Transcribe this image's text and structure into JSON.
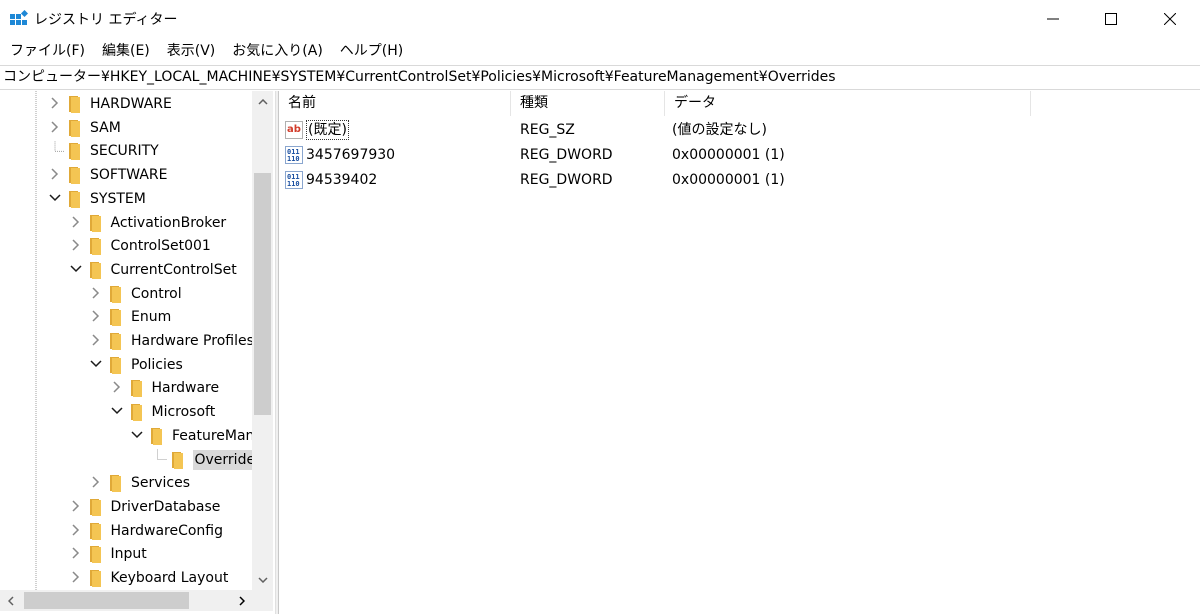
{
  "window": {
    "title": "レジストリ エディター",
    "minimize_icon": "minimize-icon",
    "maximize_icon": "maximize-icon",
    "close_icon": "close-icon"
  },
  "menu": [
    {
      "label": "ファイル(F)"
    },
    {
      "label": "編集(E)"
    },
    {
      "label": "表示(V)"
    },
    {
      "label": "お気に入り(A)"
    },
    {
      "label": "ヘルプ(H)"
    }
  ],
  "address": "コンピューター¥HKEY_LOCAL_MACHINE¥SYSTEM¥CurrentControlSet¥Policies¥Microsoft¥FeatureManagement¥Overrides",
  "tree": [
    {
      "label": "HARDWARE",
      "depth": 0,
      "state": "collapsed"
    },
    {
      "label": "SAM",
      "depth": 0,
      "state": "collapsed"
    },
    {
      "label": "SECURITY",
      "depth": 0,
      "state": "leaf"
    },
    {
      "label": "SOFTWARE",
      "depth": 0,
      "state": "collapsed"
    },
    {
      "label": "SYSTEM",
      "depth": 0,
      "state": "expanded"
    },
    {
      "label": "ActivationBroker",
      "depth": 1,
      "state": "collapsed"
    },
    {
      "label": "ControlSet001",
      "depth": 1,
      "state": "collapsed"
    },
    {
      "label": "CurrentControlSet",
      "depth": 1,
      "state": "expanded"
    },
    {
      "label": "Control",
      "depth": 2,
      "state": "collapsed"
    },
    {
      "label": "Enum",
      "depth": 2,
      "state": "collapsed"
    },
    {
      "label": "Hardware Profiles",
      "depth": 2,
      "state": "collapsed"
    },
    {
      "label": "Policies",
      "depth": 2,
      "state": "expanded"
    },
    {
      "label": "Hardware",
      "depth": 3,
      "state": "collapsed"
    },
    {
      "label": "Microsoft",
      "depth": 3,
      "state": "expanded"
    },
    {
      "label": "FeatureMana",
      "depth": 4,
      "state": "expanded"
    },
    {
      "label": "Overrides",
      "depth": 5,
      "state": "leaf",
      "selected": true
    },
    {
      "label": "Services",
      "depth": 2,
      "state": "collapsed"
    },
    {
      "label": "DriverDatabase",
      "depth": 1,
      "state": "collapsed"
    },
    {
      "label": "HardwareConfig",
      "depth": 1,
      "state": "collapsed"
    },
    {
      "label": "Input",
      "depth": 1,
      "state": "collapsed"
    },
    {
      "label": "Keyboard Layout",
      "depth": 1,
      "state": "collapsed"
    }
  ],
  "columns": [
    {
      "label": "名前"
    },
    {
      "label": "種類"
    },
    {
      "label": "データ"
    }
  ],
  "values": [
    {
      "name": "(既定)",
      "type": "REG_SZ",
      "data": "(値の設定なし)",
      "icon": "string-value-icon"
    },
    {
      "name": "3457697930",
      "type": "REG_DWORD",
      "data": "0x00000001 (1)",
      "icon": "binary-value-icon"
    },
    {
      "name": "94539402",
      "type": "REG_DWORD",
      "data": "0x00000001 (1)",
      "icon": "binary-value-icon"
    }
  ],
  "colors": {
    "folder": "#f4c553",
    "selection": "#d9d9d9",
    "scrollbar_track": "#f0f0f0",
    "scrollbar_thumb": "#cdcdcd",
    "accent": "#0078d7"
  }
}
